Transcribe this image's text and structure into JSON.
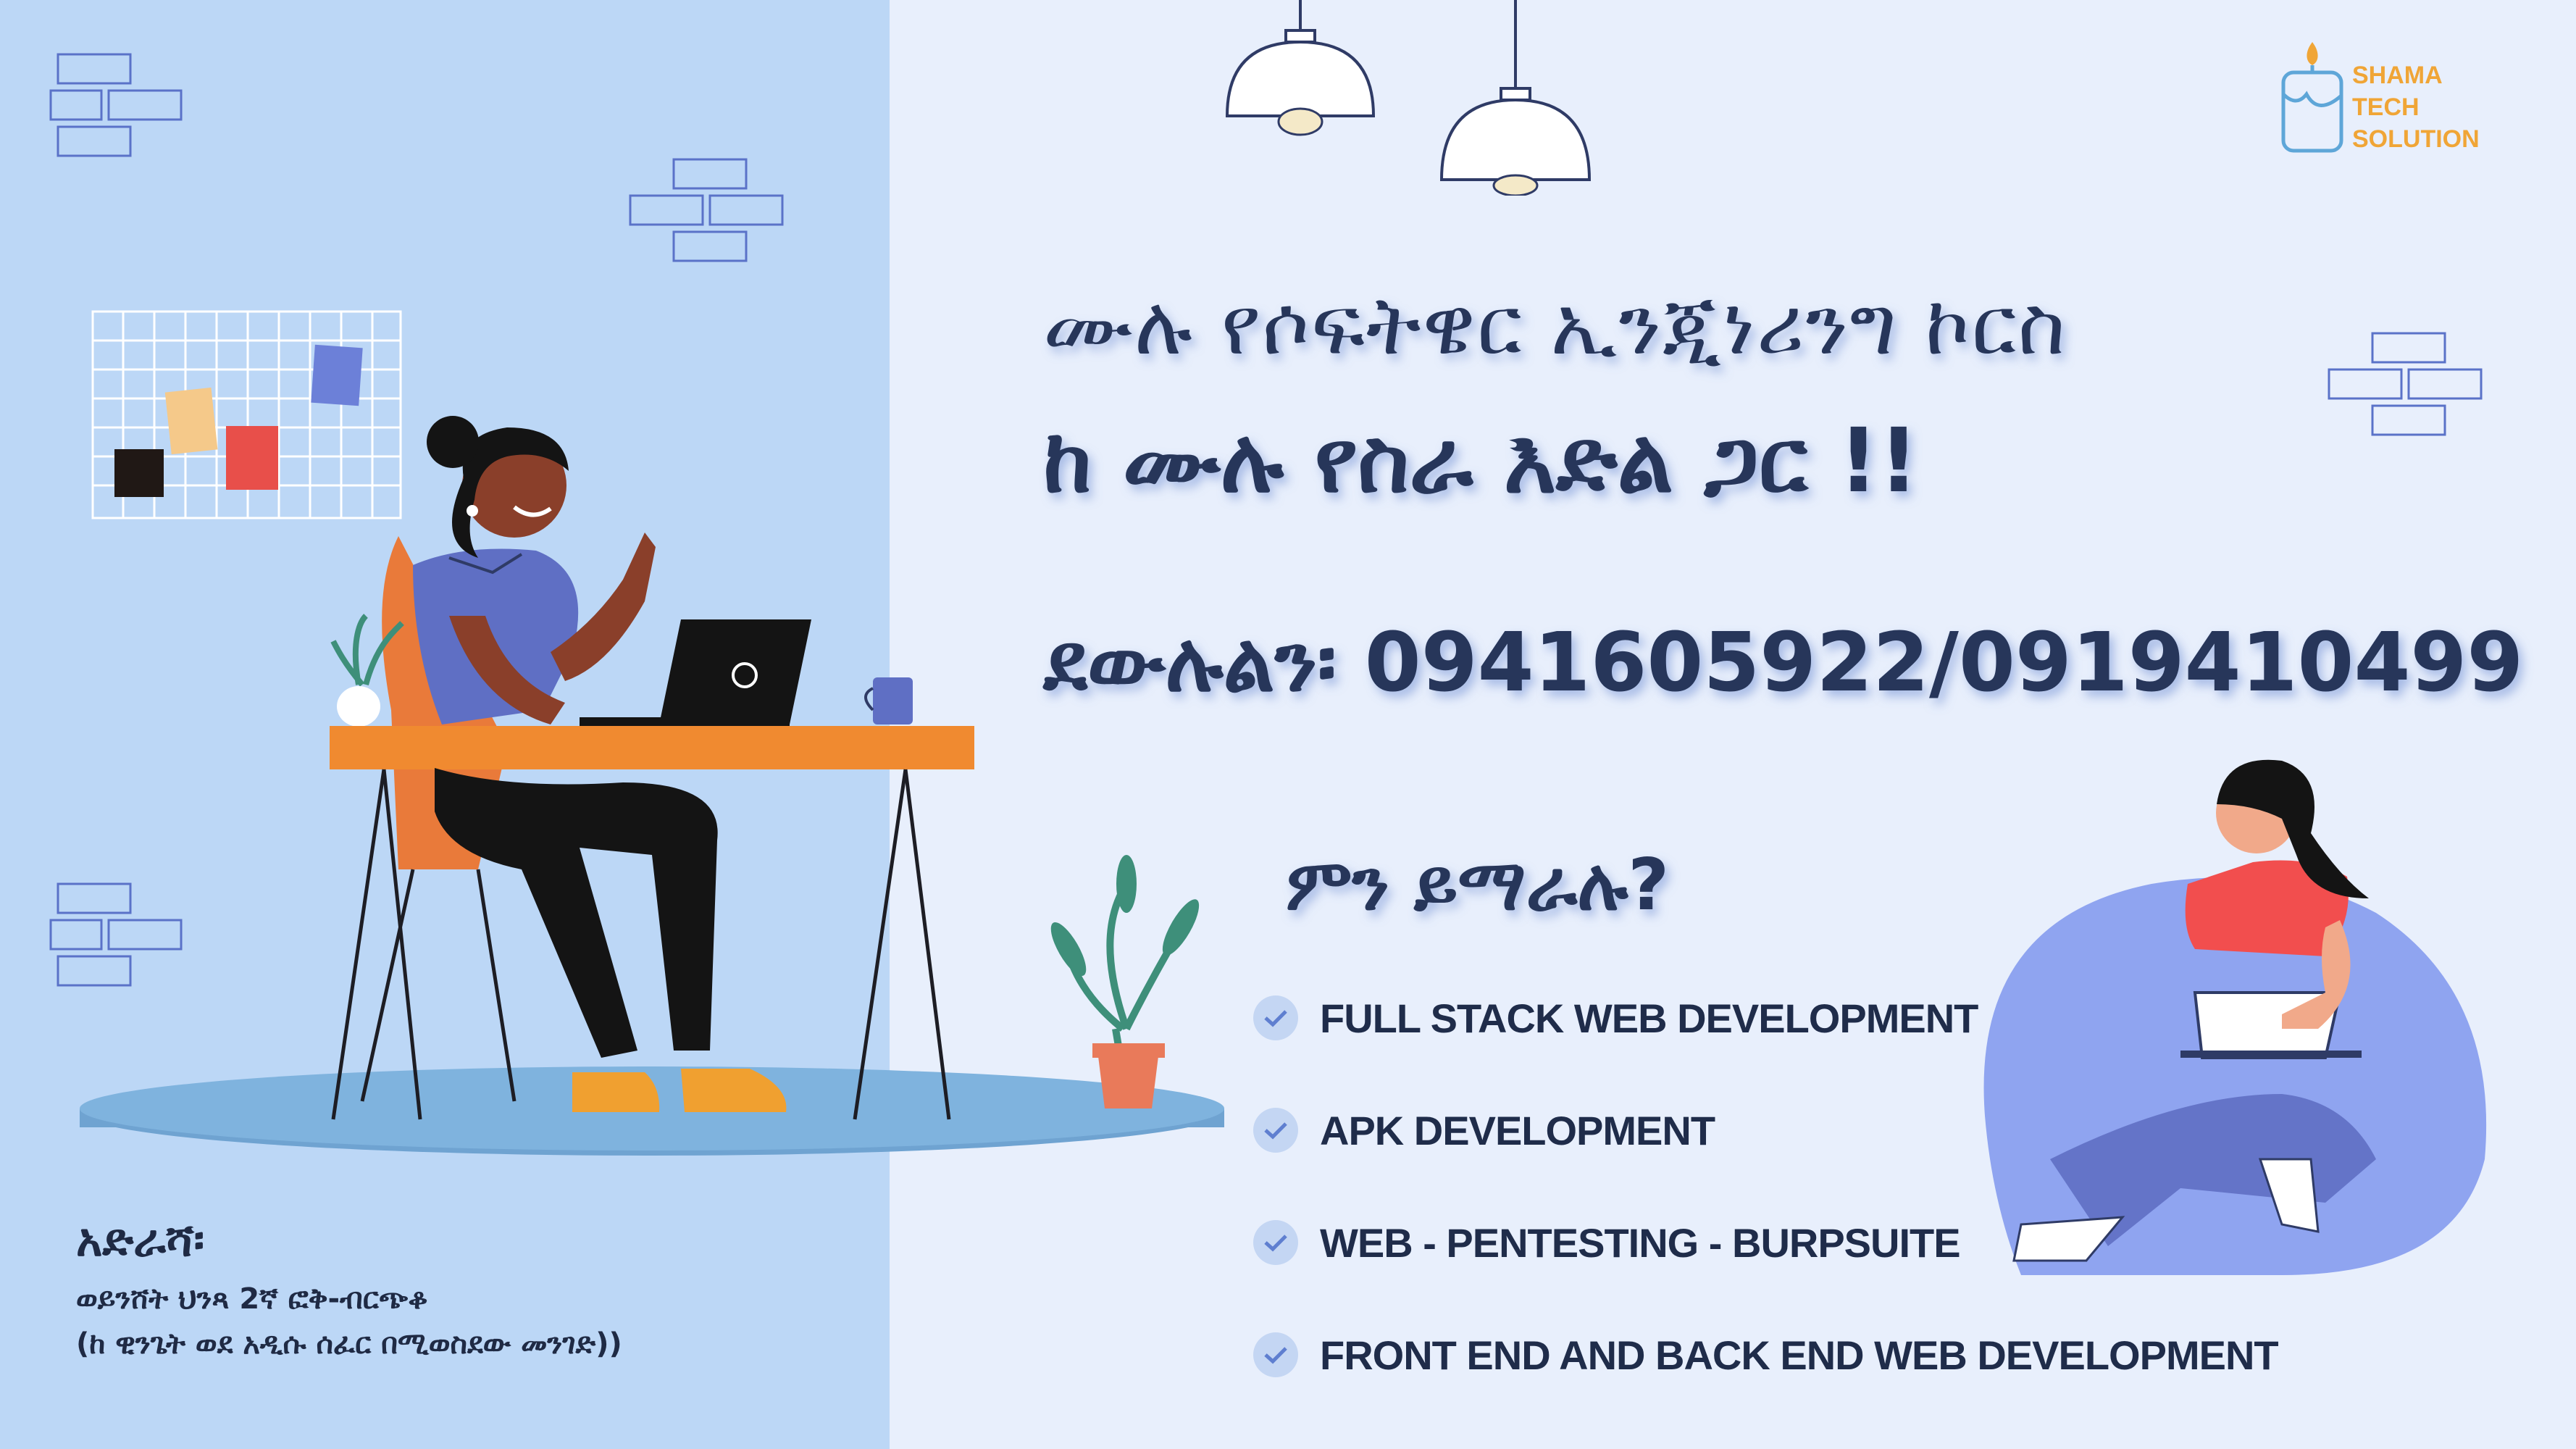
{
  "logo": {
    "lines": [
      "SHAMA",
      "TECH",
      "SOLUTION"
    ],
    "icon": "candle-icon",
    "color": "#f0a536"
  },
  "headline": {
    "line1": "ሙሉ የሶፍትዌር ኢንጂነሪንግ ኮርስ",
    "line2": "ከ ሙሉ የስራ እድል ጋር !!"
  },
  "contact": {
    "phone_text": "ደውሉልን፡ 0941605922/0919410499"
  },
  "learn": {
    "heading": "ምን  ይማራሉ?",
    "items": [
      "FULL STACK WEB DEVELOPMENT",
      "APK DEVELOPMENT",
      "WEB - PENTESTING - BURPSUITE",
      "FRONT END AND BACK END WEB DEVELOPMENT"
    ]
  },
  "address": {
    "title": "አድራሻ፡",
    "line1": "ወይንሸት ህንጻ 2ኛ ፎቅ-ብርጭቆ",
    "line2": "(ከ ዊንጌት ወደ አዲሱ ሰፈር በሚወስደው መንገድ))"
  },
  "colors": {
    "left_panel": "#bcd7f6",
    "right_panel": "#e8effc",
    "text_dark": "#27365a",
    "accent_orange": "#f0a536",
    "desk_orange": "#f08a30",
    "shirt_blue": "#5f6fc4",
    "shirt_red": "#f24e4e"
  }
}
